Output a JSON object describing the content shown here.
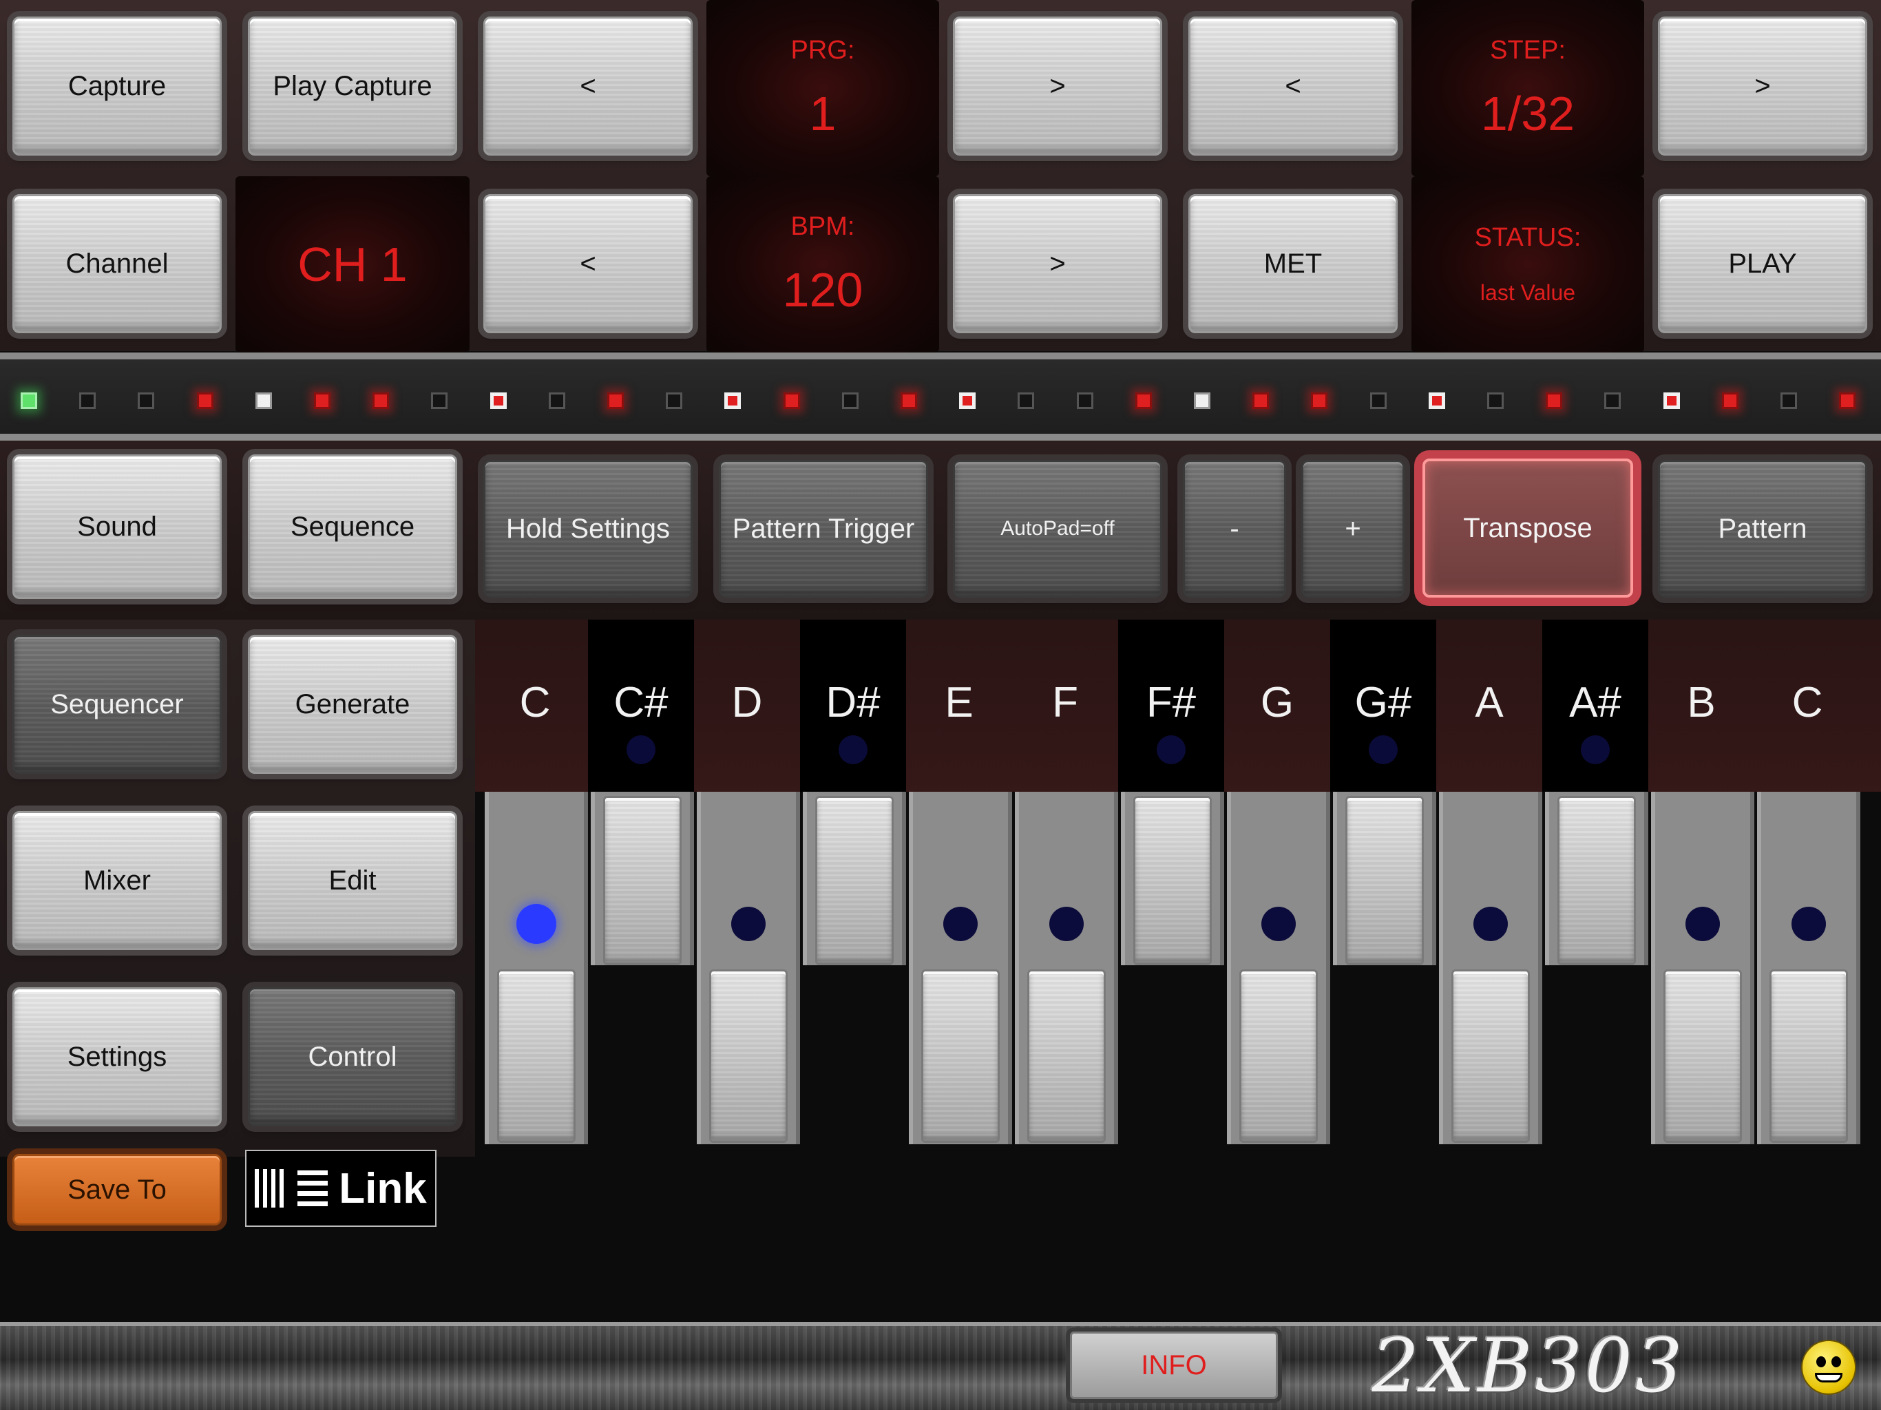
{
  "top": {
    "capture_label": "Capture",
    "play_capture_label": "Play Capture",
    "prg_prev_label": "<",
    "prg_label": "PRG:",
    "prg_value": "1",
    "prg_next_label": ">",
    "step_prev_label": "<",
    "step_label": "STEP:",
    "step_value": "1/32",
    "step_next_label": ">",
    "channel_label": "Channel",
    "channel_value": "CH 1",
    "bpm_prev_label": "<",
    "bpm_label": "BPM:",
    "bpm_value": "120",
    "bpm_next_label": ">",
    "met_label": "MET",
    "status_label": "STATUS:",
    "status_value": "last Value",
    "play_label": "PLAY"
  },
  "steps": [
    "green",
    "dark",
    "dark",
    "red",
    "white",
    "red",
    "red",
    "dark",
    "whitered",
    "dark",
    "red",
    "dark",
    "whitered",
    "red",
    "dark",
    "red",
    "whitered",
    "dark",
    "dark",
    "red",
    "white",
    "red",
    "red",
    "dark",
    "whitered",
    "dark",
    "red",
    "dark",
    "whitered",
    "red",
    "dark",
    "red"
  ],
  "mid": {
    "sound_label": "Sound",
    "sequence_label": "Sequence",
    "hold_settings_label": "Hold Settings",
    "pattern_trigger_label": "Pattern Trigger",
    "autopad_label": "AutoPad=off",
    "minus_label": "-",
    "plus_label": "+",
    "transpose_label": "Transpose",
    "pattern_label": "Pattern"
  },
  "side": {
    "sequencer_label": "Sequencer",
    "generate_label": "Generate",
    "mixer_label": "Mixer",
    "edit_label": "Edit",
    "settings_label": "Settings",
    "control_label": "Control",
    "save_to_label": "Save To",
    "link_label": "Link"
  },
  "keys": {
    "notes": [
      "C",
      "C#",
      "D",
      "D#",
      "E",
      "F",
      "F#",
      "G",
      "G#",
      "A",
      "A#",
      "B",
      "C"
    ],
    "active_note_index": 0
  },
  "bottom": {
    "info_label": "INFO",
    "brand": "2XB303"
  },
  "colors": {
    "display_red": "#e01e1e",
    "active_blue": "#2a3bff",
    "transpose_border": "#c2414a",
    "save_orange": "#e8823a"
  }
}
